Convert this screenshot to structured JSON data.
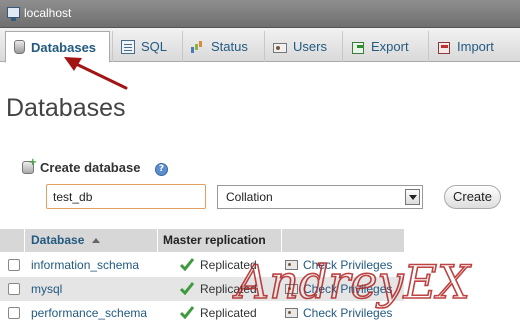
{
  "window": {
    "server_name": "localhost"
  },
  "tabs": [
    {
      "label": "Databases",
      "icon": "database-icon",
      "active": true
    },
    {
      "label": "SQL",
      "icon": "sql-icon"
    },
    {
      "label": "Status",
      "icon": "status-icon"
    },
    {
      "label": "Users",
      "icon": "users-icon"
    },
    {
      "label": "Export",
      "icon": "export-icon"
    },
    {
      "label": "Import",
      "icon": "import-icon"
    }
  ],
  "page": {
    "title": "Databases"
  },
  "create": {
    "label": "Create database",
    "db_name_value": "test_db",
    "collation_value": "Collation",
    "button_label": "Create",
    "help_icon_glyph": "?"
  },
  "table": {
    "headers": {
      "database": "Database",
      "replication": "Master replication"
    },
    "rows": [
      {
        "name": "information_schema",
        "replication": "Replicated",
        "action": "Check Privileges"
      },
      {
        "name": "mysql",
        "replication": "Replicated",
        "action": "Check Privileges"
      },
      {
        "name": "performance_schema",
        "replication": "Replicated",
        "action": "Check Privileges"
      }
    ]
  },
  "watermark": {
    "text": "AndreyEX",
    "color": "#b22222"
  },
  "colors": {
    "link": "#235a81",
    "annotation_arrow": "#a31515"
  }
}
